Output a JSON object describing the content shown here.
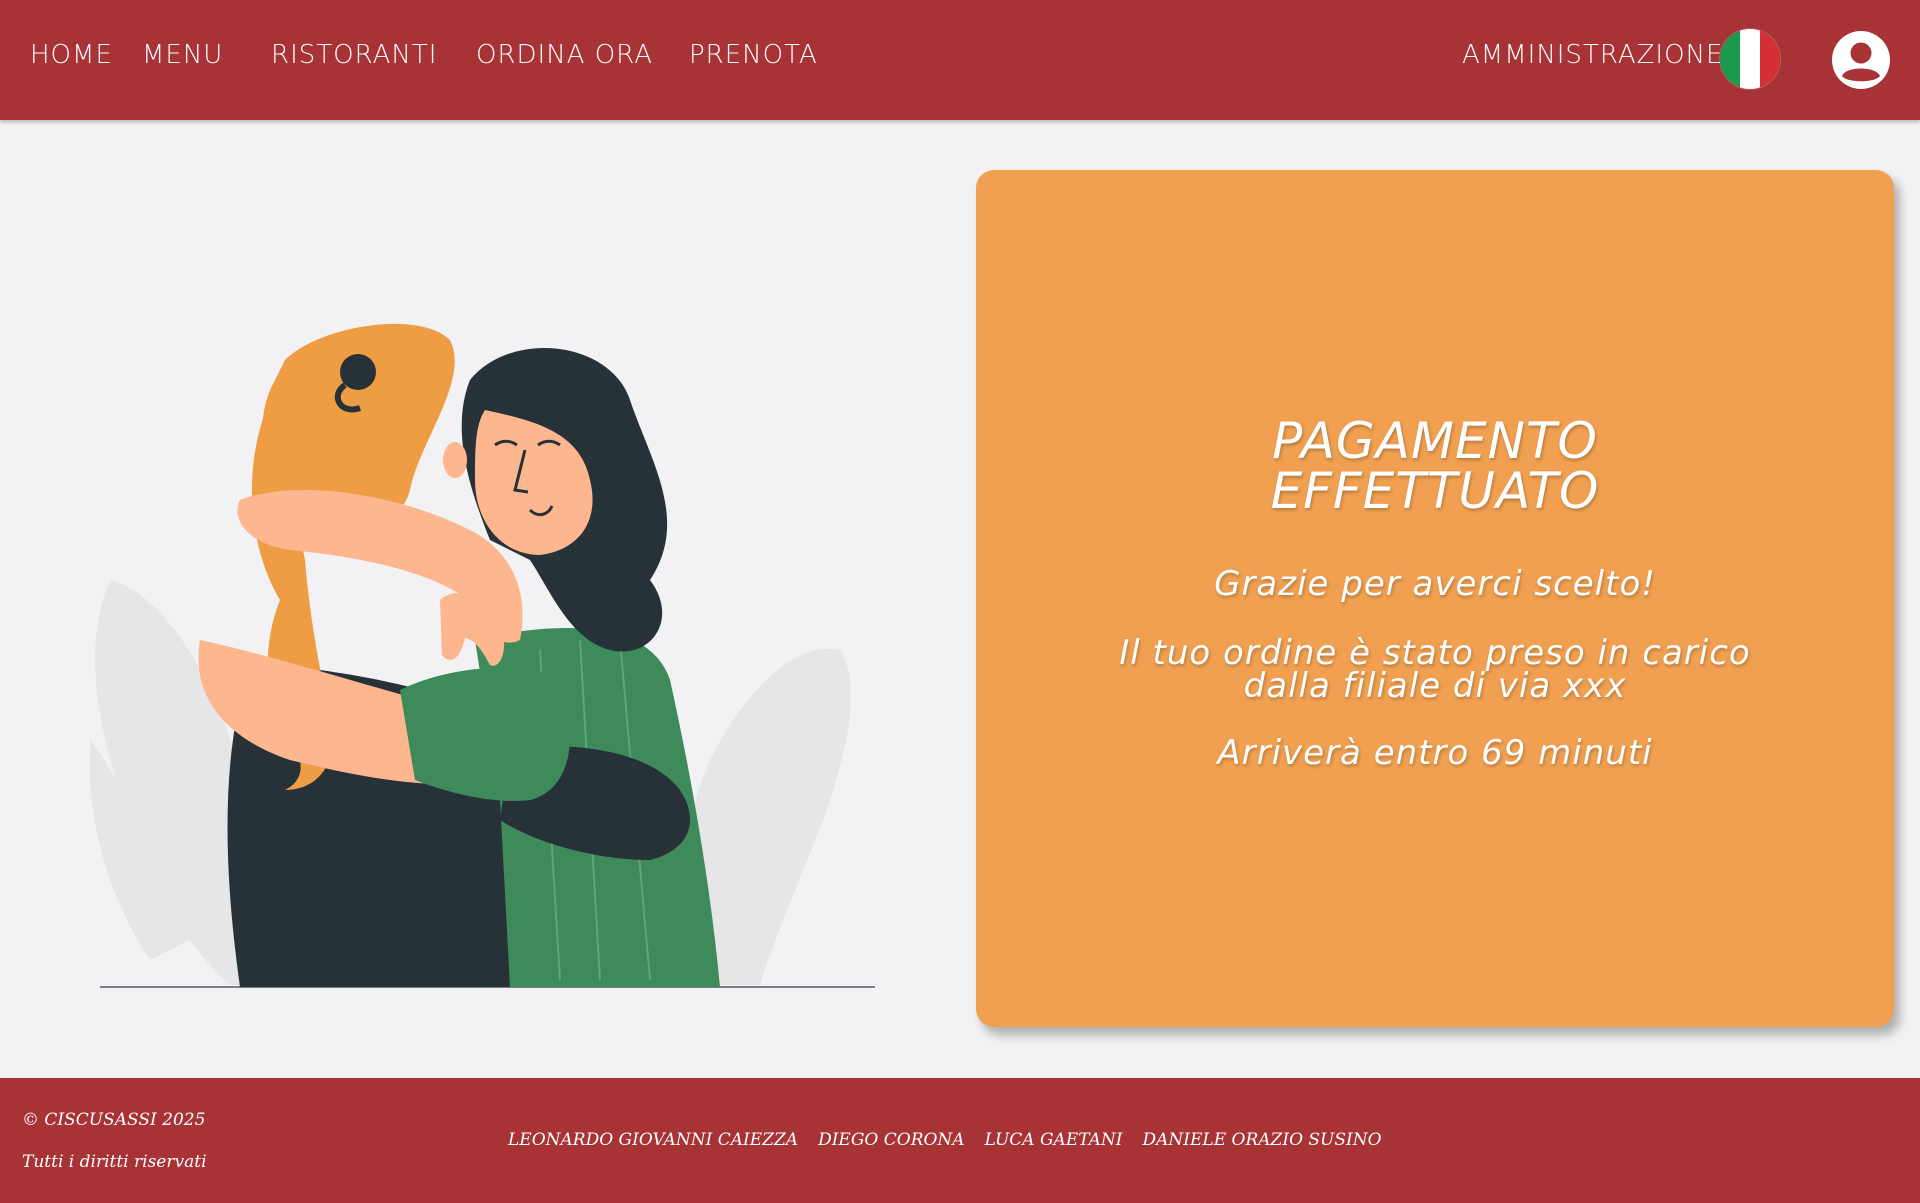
{
  "nav": {
    "home": "HOME",
    "menu": "MENU",
    "ristoranti": "RISTORANTI",
    "ordina": "ORDINA ORA",
    "prenota": "PRENOTA",
    "admin": "AMMINISTRAZIONE"
  },
  "flag_colors": [
    "#1a9a4a",
    "#ffffff",
    "#d32f35"
  ],
  "card": {
    "title_line1": "PAGAMENTO",
    "title_line2": "EFFETTUATO",
    "thanks": "Grazie per averci scelto!",
    "order_line1": "Il tuo ordine è stato preso in carico",
    "order_line2": "dalla filiale di via xxx",
    "eta": "Arriverà entro 69 minuti"
  },
  "footer": {
    "copyright": "© CISCUSASSI 2025",
    "rights": "Tutti i diritti riservati",
    "authors": [
      "LEONARDO GIOVANNI CAIEZZA",
      "DIEGO CORONA",
      "LUCA GAETANI",
      "DANIELE ORAZIO SUSINO"
    ]
  },
  "colors": {
    "brand_red": "#a83336",
    "card_orange": "#f0a050",
    "background": "#f2f2f4"
  }
}
